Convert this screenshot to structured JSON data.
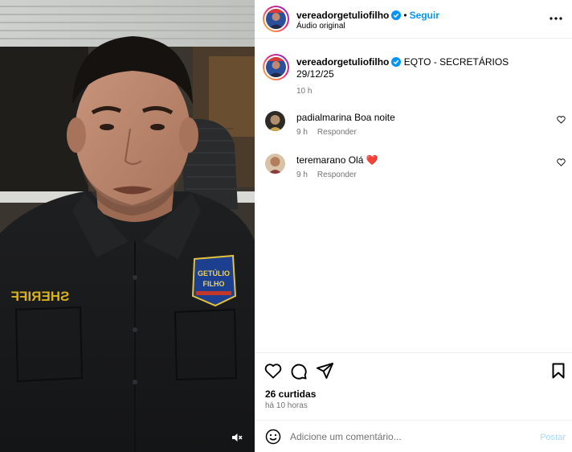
{
  "post": {
    "username": "vereadorgetuliofilho",
    "follow_label": "Seguir",
    "separator": "•",
    "audio_label": "Áudio original",
    "caption_text": "EQTO - SECRETÁRIOS",
    "caption_date": "29/12/25",
    "caption_time": "10 h",
    "likes_text": "26 curtidas",
    "posted_ago": "há 10 horas"
  },
  "video": {
    "shirt_patch_text": "SHERIFF",
    "badge_lines": [
      "GETÚLIO",
      "FILHO"
    ]
  },
  "comments": [
    {
      "username": "padialmarina",
      "text": "Boa noite",
      "time": "9 h",
      "reply_label": "Responder"
    },
    {
      "username": "teremarano",
      "text": "Olá",
      "emoji": "❤️",
      "time": "9 h",
      "reply_label": "Responder"
    }
  ],
  "comment_box": {
    "placeholder": "Adicione um comentário...",
    "post_label": "Postar"
  },
  "icons": {
    "more": "more-horizontal-icon",
    "like": "heart-icon",
    "comment": "comment-icon",
    "share": "send-icon",
    "save": "bookmark-icon",
    "emoji": "smiley-icon",
    "mute": "speaker-muted-icon",
    "verified": "verified-badge-icon"
  },
  "colors": {
    "accent_blue": "#0095f6",
    "verified_blue": "#0095f6",
    "muted_text": "#737373",
    "post_disabled": "#a8d8fb",
    "heart_pink": "#ed4956"
  }
}
